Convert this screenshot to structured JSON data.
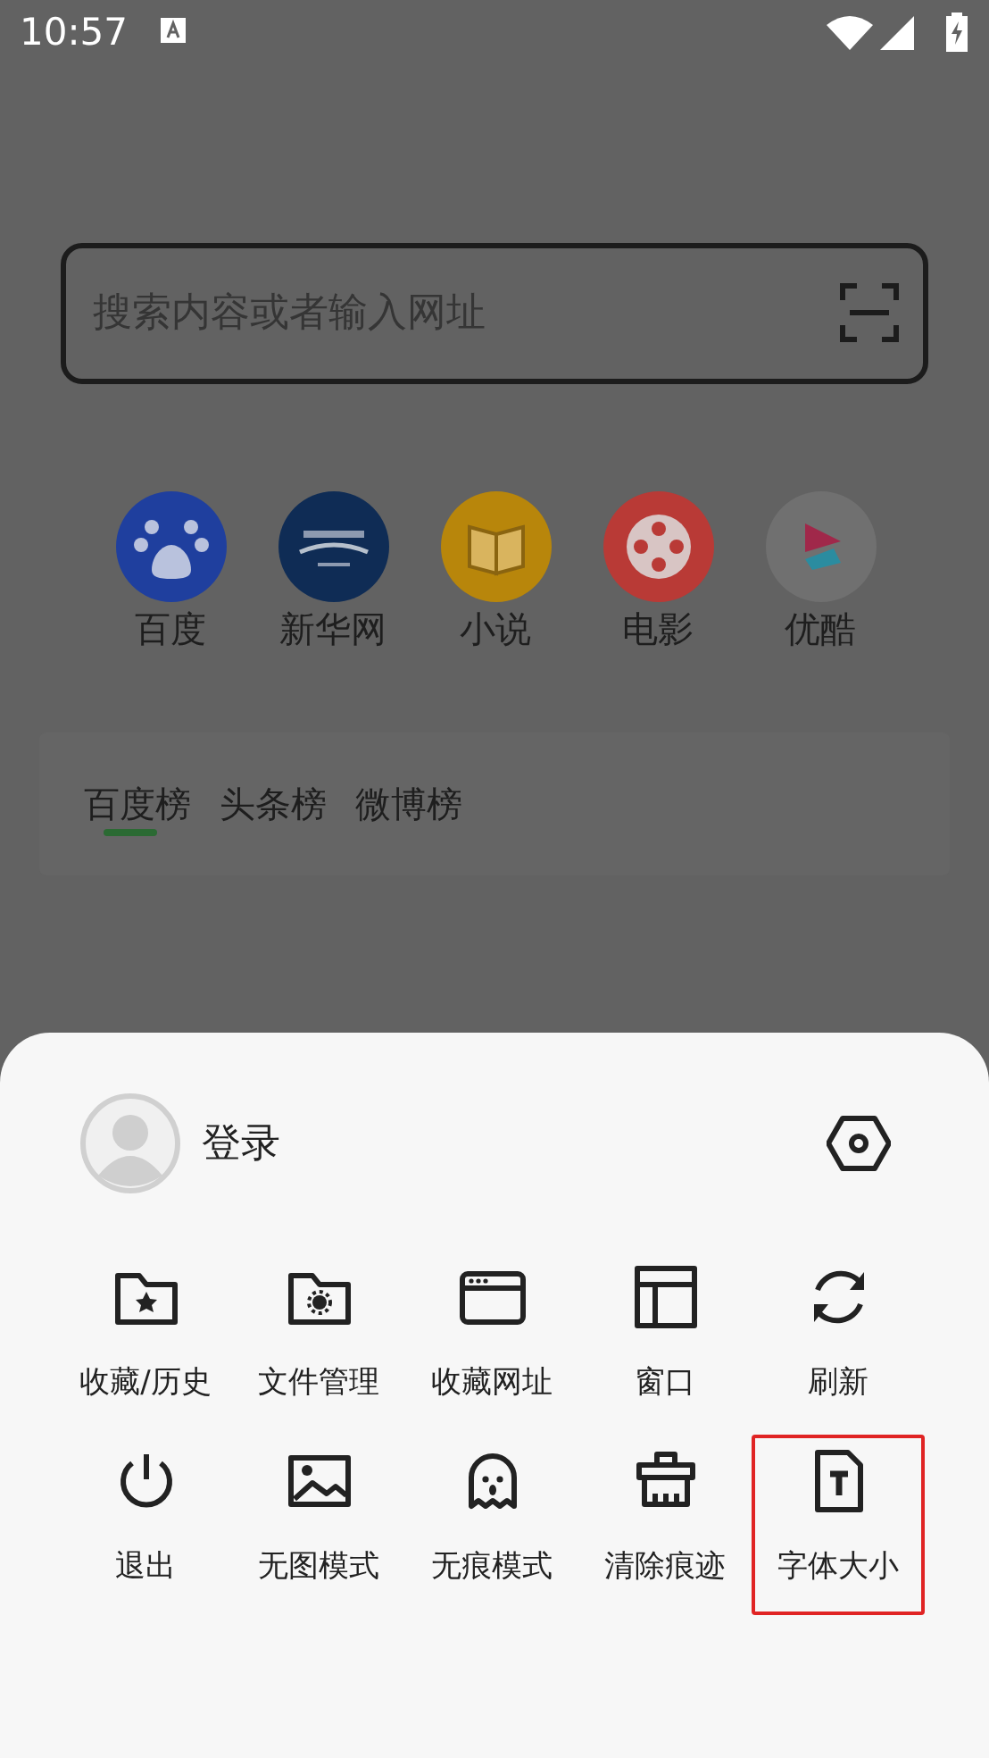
{
  "status_bar": {
    "time": "10:57"
  },
  "search": {
    "placeholder": "搜索内容或者输入网址"
  },
  "quick_links": [
    {
      "label": "百度",
      "kind": "paw"
    },
    {
      "label": "新华网",
      "kind": "globe"
    },
    {
      "label": "小说",
      "kind": "book"
    },
    {
      "label": "电影",
      "kind": "film"
    },
    {
      "label": "优酷",
      "kind": "play"
    }
  ],
  "hot_tabs": [
    {
      "label": "百度榜",
      "selected": true
    },
    {
      "label": "头条榜",
      "selected": false
    },
    {
      "label": "微博榜",
      "selected": false
    }
  ],
  "menu": {
    "account": {
      "label": "登录"
    },
    "items": [
      {
        "label": "收藏/历史",
        "kind": "star-folder",
        "highlighted": false
      },
      {
        "label": "文件管理",
        "kind": "gear-folder",
        "highlighted": false
      },
      {
        "label": "收藏网址",
        "kind": "browser",
        "highlighted": false
      },
      {
        "label": "窗口",
        "kind": "layout",
        "highlighted": false
      },
      {
        "label": "刷新",
        "kind": "refresh",
        "highlighted": false
      },
      {
        "label": "退出",
        "kind": "power",
        "highlighted": false
      },
      {
        "label": "无图模式",
        "kind": "image",
        "highlighted": false
      },
      {
        "label": "无痕模式",
        "kind": "ghost",
        "highlighted": false
      },
      {
        "label": "清除痕迹",
        "kind": "brush",
        "highlighted": false
      },
      {
        "label": "字体大小",
        "kind": "font-file",
        "highlighted": true
      }
    ]
  }
}
